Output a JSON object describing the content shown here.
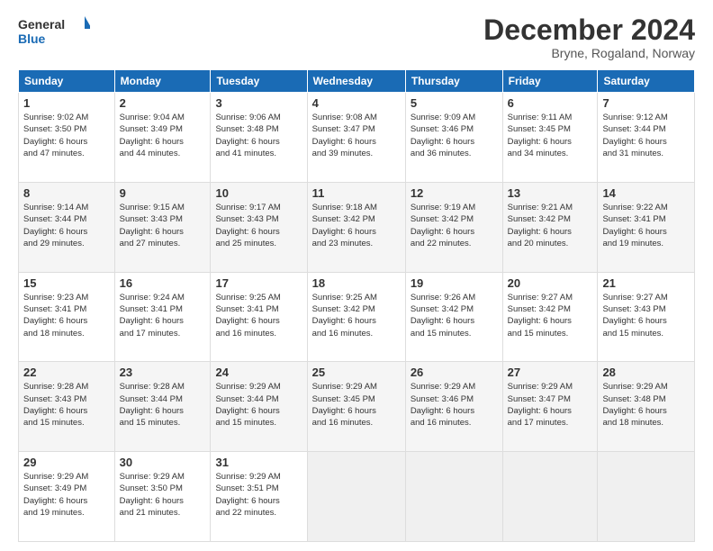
{
  "logo": {
    "line1": "General",
    "line2": "Blue"
  },
  "title": "December 2024",
  "subtitle": "Bryne, Rogaland, Norway",
  "headers": [
    "Sunday",
    "Monday",
    "Tuesday",
    "Wednesday",
    "Thursday",
    "Friday",
    "Saturday"
  ],
  "weeks": [
    [
      {
        "day": "1",
        "info": "Sunrise: 9:02 AM\nSunset: 3:50 PM\nDaylight: 6 hours\nand 47 minutes."
      },
      {
        "day": "2",
        "info": "Sunrise: 9:04 AM\nSunset: 3:49 PM\nDaylight: 6 hours\nand 44 minutes."
      },
      {
        "day": "3",
        "info": "Sunrise: 9:06 AM\nSunset: 3:48 PM\nDaylight: 6 hours\nand 41 minutes."
      },
      {
        "day": "4",
        "info": "Sunrise: 9:08 AM\nSunset: 3:47 PM\nDaylight: 6 hours\nand 39 minutes."
      },
      {
        "day": "5",
        "info": "Sunrise: 9:09 AM\nSunset: 3:46 PM\nDaylight: 6 hours\nand 36 minutes."
      },
      {
        "day": "6",
        "info": "Sunrise: 9:11 AM\nSunset: 3:45 PM\nDaylight: 6 hours\nand 34 minutes."
      },
      {
        "day": "7",
        "info": "Sunrise: 9:12 AM\nSunset: 3:44 PM\nDaylight: 6 hours\nand 31 minutes."
      }
    ],
    [
      {
        "day": "8",
        "info": "Sunrise: 9:14 AM\nSunset: 3:44 PM\nDaylight: 6 hours\nand 29 minutes."
      },
      {
        "day": "9",
        "info": "Sunrise: 9:15 AM\nSunset: 3:43 PM\nDaylight: 6 hours\nand 27 minutes."
      },
      {
        "day": "10",
        "info": "Sunrise: 9:17 AM\nSunset: 3:43 PM\nDaylight: 6 hours\nand 25 minutes."
      },
      {
        "day": "11",
        "info": "Sunrise: 9:18 AM\nSunset: 3:42 PM\nDaylight: 6 hours\nand 23 minutes."
      },
      {
        "day": "12",
        "info": "Sunrise: 9:19 AM\nSunset: 3:42 PM\nDaylight: 6 hours\nand 22 minutes."
      },
      {
        "day": "13",
        "info": "Sunrise: 9:21 AM\nSunset: 3:42 PM\nDaylight: 6 hours\nand 20 minutes."
      },
      {
        "day": "14",
        "info": "Sunrise: 9:22 AM\nSunset: 3:41 PM\nDaylight: 6 hours\nand 19 minutes."
      }
    ],
    [
      {
        "day": "15",
        "info": "Sunrise: 9:23 AM\nSunset: 3:41 PM\nDaylight: 6 hours\nand 18 minutes."
      },
      {
        "day": "16",
        "info": "Sunrise: 9:24 AM\nSunset: 3:41 PM\nDaylight: 6 hours\nand 17 minutes."
      },
      {
        "day": "17",
        "info": "Sunrise: 9:25 AM\nSunset: 3:41 PM\nDaylight: 6 hours\nand 16 minutes."
      },
      {
        "day": "18",
        "info": "Sunrise: 9:25 AM\nSunset: 3:42 PM\nDaylight: 6 hours\nand 16 minutes."
      },
      {
        "day": "19",
        "info": "Sunrise: 9:26 AM\nSunset: 3:42 PM\nDaylight: 6 hours\nand 15 minutes."
      },
      {
        "day": "20",
        "info": "Sunrise: 9:27 AM\nSunset: 3:42 PM\nDaylight: 6 hours\nand 15 minutes."
      },
      {
        "day": "21",
        "info": "Sunrise: 9:27 AM\nSunset: 3:43 PM\nDaylight: 6 hours\nand 15 minutes."
      }
    ],
    [
      {
        "day": "22",
        "info": "Sunrise: 9:28 AM\nSunset: 3:43 PM\nDaylight: 6 hours\nand 15 minutes."
      },
      {
        "day": "23",
        "info": "Sunrise: 9:28 AM\nSunset: 3:44 PM\nDaylight: 6 hours\nand 15 minutes."
      },
      {
        "day": "24",
        "info": "Sunrise: 9:29 AM\nSunset: 3:44 PM\nDaylight: 6 hours\nand 15 minutes."
      },
      {
        "day": "25",
        "info": "Sunrise: 9:29 AM\nSunset: 3:45 PM\nDaylight: 6 hours\nand 16 minutes."
      },
      {
        "day": "26",
        "info": "Sunrise: 9:29 AM\nSunset: 3:46 PM\nDaylight: 6 hours\nand 16 minutes."
      },
      {
        "day": "27",
        "info": "Sunrise: 9:29 AM\nSunset: 3:47 PM\nDaylight: 6 hours\nand 17 minutes."
      },
      {
        "day": "28",
        "info": "Sunrise: 9:29 AM\nSunset: 3:48 PM\nDaylight: 6 hours\nand 18 minutes."
      }
    ],
    [
      {
        "day": "29",
        "info": "Sunrise: 9:29 AM\nSunset: 3:49 PM\nDaylight: 6 hours\nand 19 minutes."
      },
      {
        "day": "30",
        "info": "Sunrise: 9:29 AM\nSunset: 3:50 PM\nDaylight: 6 hours\nand 21 minutes."
      },
      {
        "day": "31",
        "info": "Sunrise: 9:29 AM\nSunset: 3:51 PM\nDaylight: 6 hours\nand 22 minutes."
      },
      {
        "day": "",
        "info": ""
      },
      {
        "day": "",
        "info": ""
      },
      {
        "day": "",
        "info": ""
      },
      {
        "day": "",
        "info": ""
      }
    ]
  ]
}
